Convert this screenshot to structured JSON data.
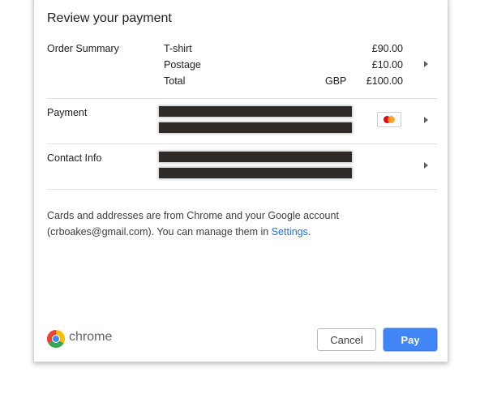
{
  "dialog": {
    "title": "Review your payment"
  },
  "order_summary": {
    "label": "Order Summary",
    "items": [
      {
        "name": "T-shirt",
        "amount": "£90.00"
      },
      {
        "name": "Postage",
        "amount": "£10.00"
      }
    ],
    "total": {
      "name": "Total",
      "currency": "GBP",
      "amount": "£100.00"
    }
  },
  "payment": {
    "label": "Payment",
    "card_icon": "mastercard-icon"
  },
  "contact": {
    "label": "Contact Info"
  },
  "note": {
    "text_before": "Cards and addresses are from Chrome and your Google account (crboakes@gmail.com). You can manage them in ",
    "link_text": "Settings",
    "text_after": "."
  },
  "footer": {
    "brand": "chrome",
    "cancel_label": "Cancel",
    "pay_label": "Pay"
  },
  "colors": {
    "accent": "#4285f4",
    "link": "#1a73e8"
  }
}
